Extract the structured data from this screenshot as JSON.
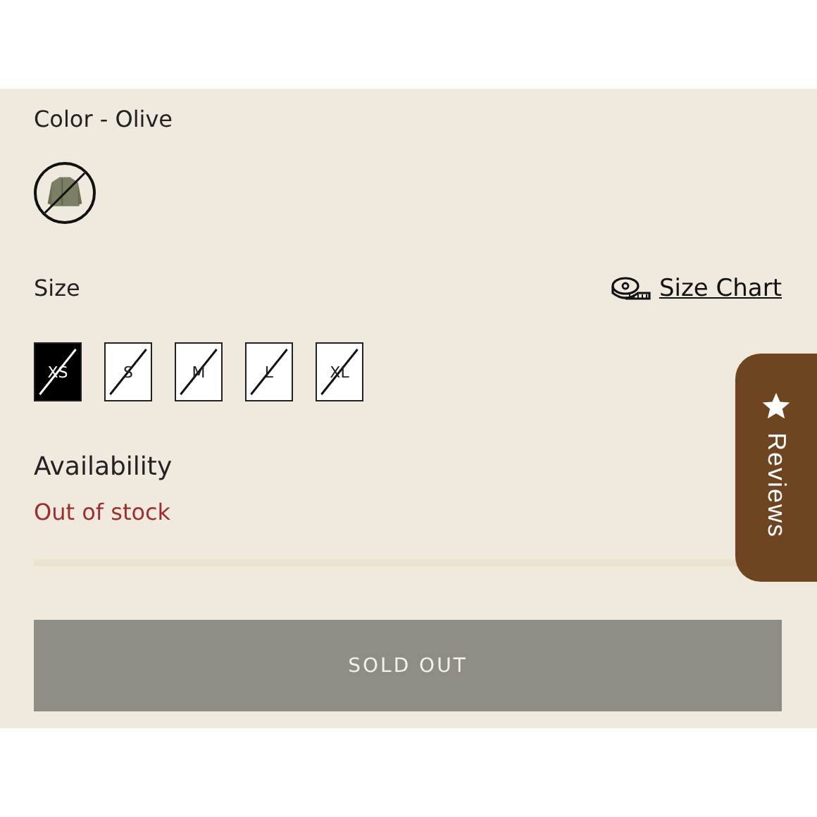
{
  "color": {
    "label": "Color - Olive",
    "swatches": [
      {
        "selected": true,
        "unavailable": true
      }
    ]
  },
  "size": {
    "label": "Size",
    "size_chart_link": "Size Chart",
    "options": [
      {
        "label": "XS",
        "selected": true,
        "unavailable": true
      },
      {
        "label": "S",
        "selected": false,
        "unavailable": true
      },
      {
        "label": "M",
        "selected": false,
        "unavailable": true
      },
      {
        "label": "L",
        "selected": false,
        "unavailable": true
      },
      {
        "label": "XL",
        "selected": false,
        "unavailable": true
      }
    ]
  },
  "availability": {
    "label": "Availability",
    "status": "Out of stock"
  },
  "button": {
    "label": "SOLD OUT",
    "disabled": true
  },
  "reviews_tab": {
    "label": "Reviews"
  }
}
